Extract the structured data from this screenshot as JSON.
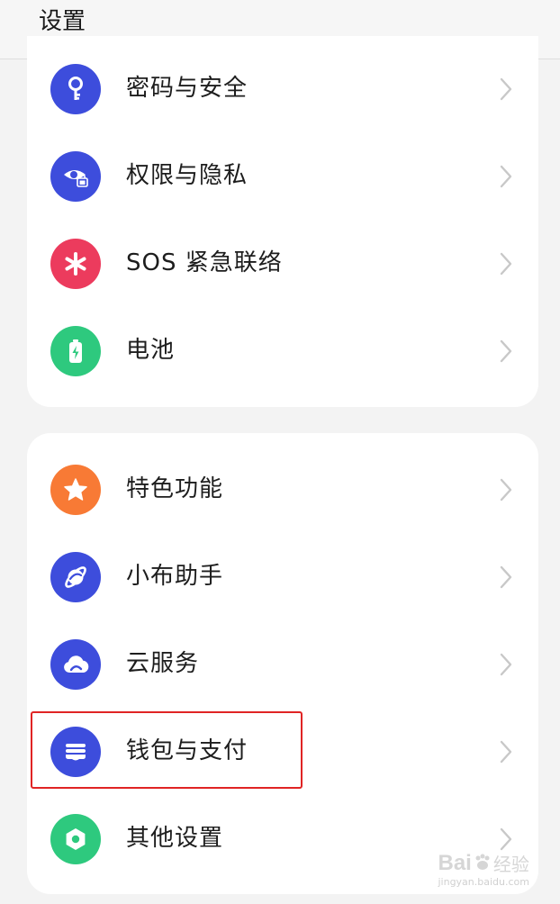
{
  "header": {
    "title": "设置"
  },
  "group1": [
    {
      "label": "密码与安全",
      "icon": "key-icon",
      "color": "#3d4ddc"
    },
    {
      "label": "权限与隐私",
      "icon": "eye-lock-icon",
      "color": "#3d4ddc"
    },
    {
      "label": "SOS 紧急联络",
      "icon": "asterisk-icon",
      "color": "#ec3b5d"
    },
    {
      "label": "电池",
      "icon": "battery-icon",
      "color": "#2ec97e"
    }
  ],
  "group2": [
    {
      "label": "特色功能",
      "icon": "star-icon",
      "color": "#f87a35"
    },
    {
      "label": "小布助手",
      "icon": "assistant-orbit-icon",
      "color": "#3d4ddc"
    },
    {
      "label": "云服务",
      "icon": "cloud-icon",
      "color": "#3d4ddc"
    },
    {
      "label": "钱包与支付",
      "icon": "wallet-icon",
      "color": "#3d4ddc"
    },
    {
      "label": "其他设置",
      "icon": "gear-icon",
      "color": "#2ec97e"
    }
  ],
  "highlighted_item": "钱包与支付",
  "watermark": {
    "brand": "Bai",
    "brand2": "经验",
    "url": "jingyan.baidu.com"
  }
}
